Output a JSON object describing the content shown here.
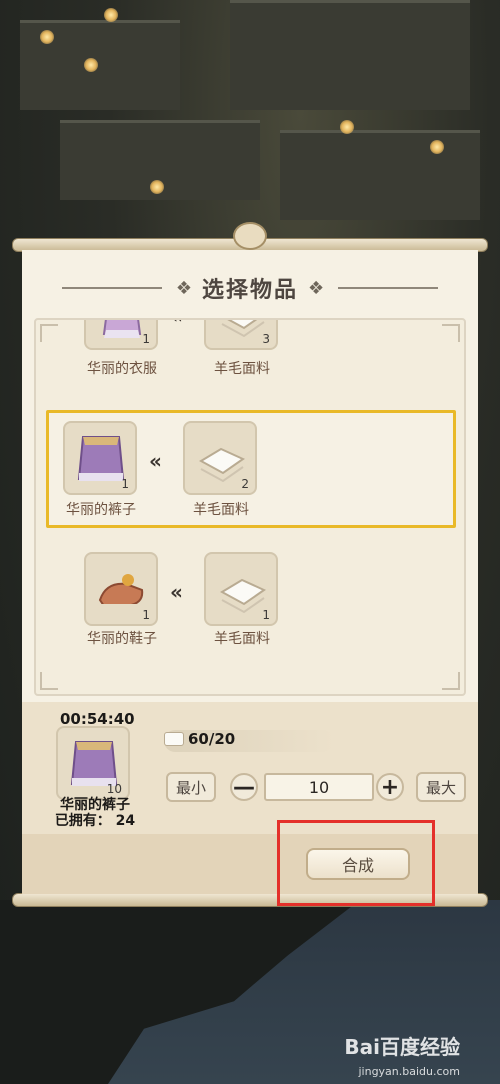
{
  "panel": {
    "title": "选择物品"
  },
  "recipes": [
    {
      "product": {
        "name": "华丽的衣服",
        "count": "1"
      },
      "material": {
        "name": "羊毛面料",
        "count": "3"
      }
    },
    {
      "product": {
        "name": "华丽的裤子",
        "count": "1"
      },
      "material": {
        "name": "羊毛面料",
        "count": "2"
      }
    },
    {
      "product": {
        "name": "华丽的鞋子",
        "count": "1"
      },
      "material": {
        "name": "羊毛面料",
        "count": "1"
      }
    }
  ],
  "selected_index": 1,
  "craft": {
    "timer": "00:54:40",
    "result_count": "10",
    "result_name": "华丽的裤子",
    "owned_text": "已拥有： 24",
    "cost": "60/20",
    "min_label": "最小",
    "minus": "—",
    "quantity": "10",
    "plus": "+",
    "max_label": "最大",
    "craft_label": "合成"
  },
  "watermark": {
    "logo": "Bai百度经验",
    "url": "jingyan.baidu.com"
  },
  "colors": {
    "selected_border": "#e9b928",
    "highlight": "#e4302a",
    "panel_bg": "#f6f1e4"
  }
}
